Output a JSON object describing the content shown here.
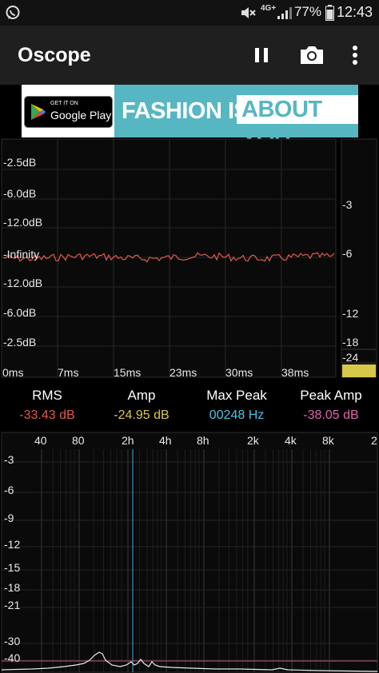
{
  "status_bar": {
    "notification_icon": "whatsapp-icon",
    "network": "4G+",
    "battery": "77%",
    "time": "12:43"
  },
  "app_bar": {
    "title": "Oscope",
    "actions": [
      "pause-icon",
      "camera-icon",
      "more-vert-icon"
    ]
  },
  "ad": {
    "store_small": "GET IT ON",
    "store_big": "Google Play",
    "text_a": "FASHION IS",
    "text_b": "ABOUT YOU"
  },
  "waveform_panel": {
    "db_labels": [
      "-2.5dB",
      "-6.0dB",
      "-12.0dB",
      "-Infinity",
      "-12.0dB",
      "-6.0dB",
      "-2.5dB"
    ],
    "time_labels": [
      "0ms",
      "7ms",
      "15ms",
      "23ms",
      "30ms",
      "38ms"
    ],
    "meter_labels": [
      "-3",
      "-6",
      "-12",
      "-18",
      "-24"
    ],
    "meter_level_color": "#d8c84a",
    "waveform_color": "#e05a4f"
  },
  "stats": [
    {
      "label": "RMS",
      "value": "-33.43 dB",
      "color": "#e05a4f"
    },
    {
      "label": "Amp",
      "value": "-24.95 dB",
      "color": "#d8c84a"
    },
    {
      "label": "Max Peak",
      "value": "00248 Hz",
      "color": "#4fc3e0"
    },
    {
      "label": "Peak Amp",
      "value": "-38.05 dB",
      "color": "#e064b0"
    }
  ],
  "spectrum_panel": {
    "freq_labels": [
      "40",
      "80",
      "2h",
      "4h",
      "8h",
      "2k",
      "4k",
      "8k",
      "2"
    ],
    "db_labels": [
      "-3",
      "-6",
      "-9",
      "-12",
      "-15",
      "-18",
      "-21",
      "-30",
      "-40"
    ],
    "peak_marker_color": "#4fa8d8",
    "threshold_color": "#c0507a"
  }
}
